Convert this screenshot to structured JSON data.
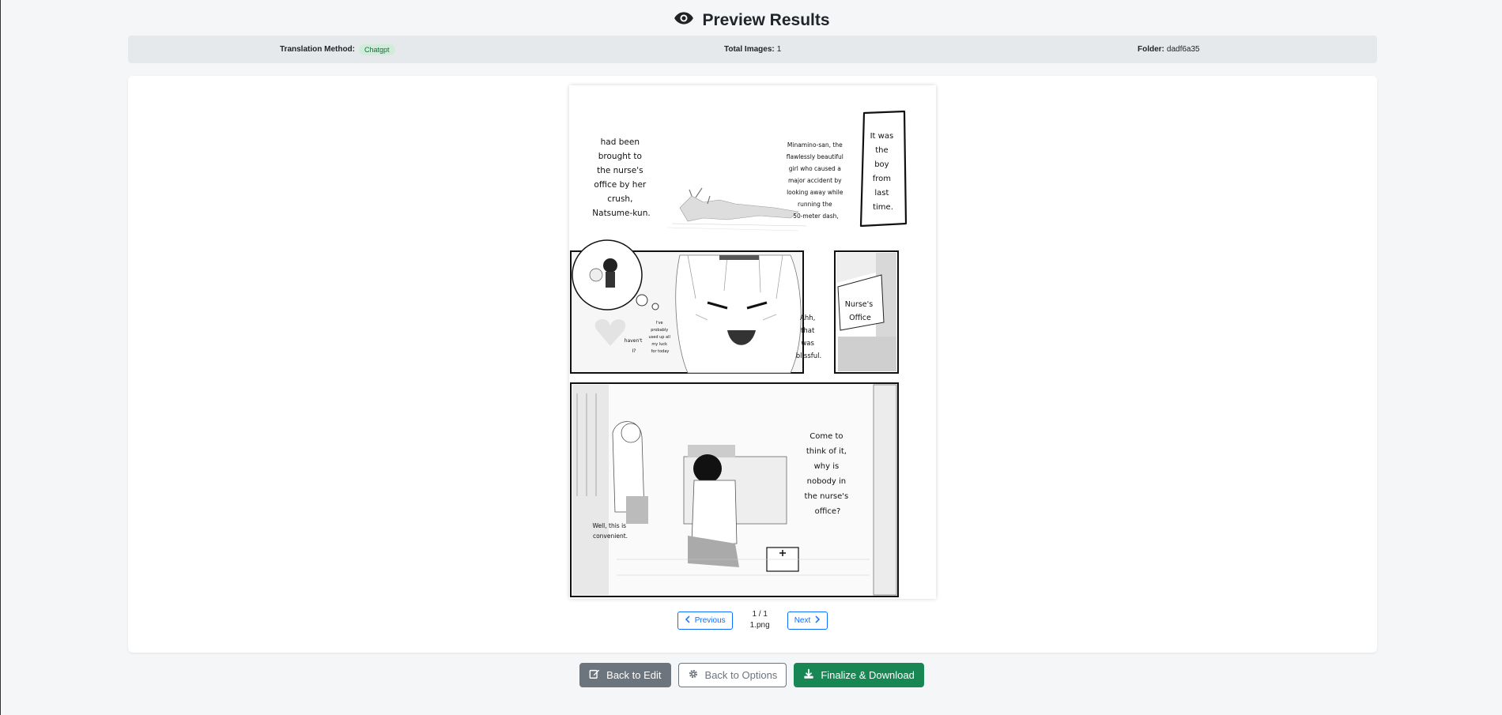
{
  "header": {
    "title": "Preview Results",
    "icon": "eye-icon"
  },
  "info": {
    "method_label": "Translation Method:",
    "method_value": "Chatgpt",
    "total_label": "Total Images:",
    "total_value": "1",
    "folder_label": "Folder:",
    "folder_value": "dadf6a35"
  },
  "manga": {
    "panel1_left": [
      "had been",
      "brought to",
      "the nurse's",
      "office by her",
      "crush,",
      "Natsume-kun."
    ],
    "panel1_mid": [
      "Minamino-san, the",
      "flawlessly beautiful",
      "girl who caused a",
      "major accident by",
      "looking away while",
      "running the",
      "50-meter dash,"
    ],
    "panel1_box": [
      "It was",
      "the",
      "boy",
      "from",
      "last",
      "time."
    ],
    "panel2_small_left": [
      "haven't",
      "I?"
    ],
    "panel2_small_right": [
      "I've",
      "probably",
      "used up all",
      "my luck",
      "for today"
    ],
    "panel2_right": [
      "Ahh,",
      "that",
      "was",
      "blissful."
    ],
    "panel3_sign": [
      "Nurse's",
      "Office"
    ],
    "panel4_right": [
      "Come to",
      "think of it,",
      "why is",
      "nobody in",
      "the nurse's",
      "office?"
    ],
    "panel4_left": [
      "Well, this is",
      "convenient."
    ]
  },
  "pager": {
    "prev_label": "Previous",
    "next_label": "Next",
    "page_indicator": "1 / 1",
    "filename": "1.png"
  },
  "actions": {
    "back_edit": "Back to Edit",
    "back_options": "Back to Options",
    "finalize": "Finalize & Download"
  },
  "colors": {
    "primary": "#0d6efd",
    "secondary": "#6c757d",
    "success": "#198754",
    "badge_bg": "#d1ecd8"
  }
}
